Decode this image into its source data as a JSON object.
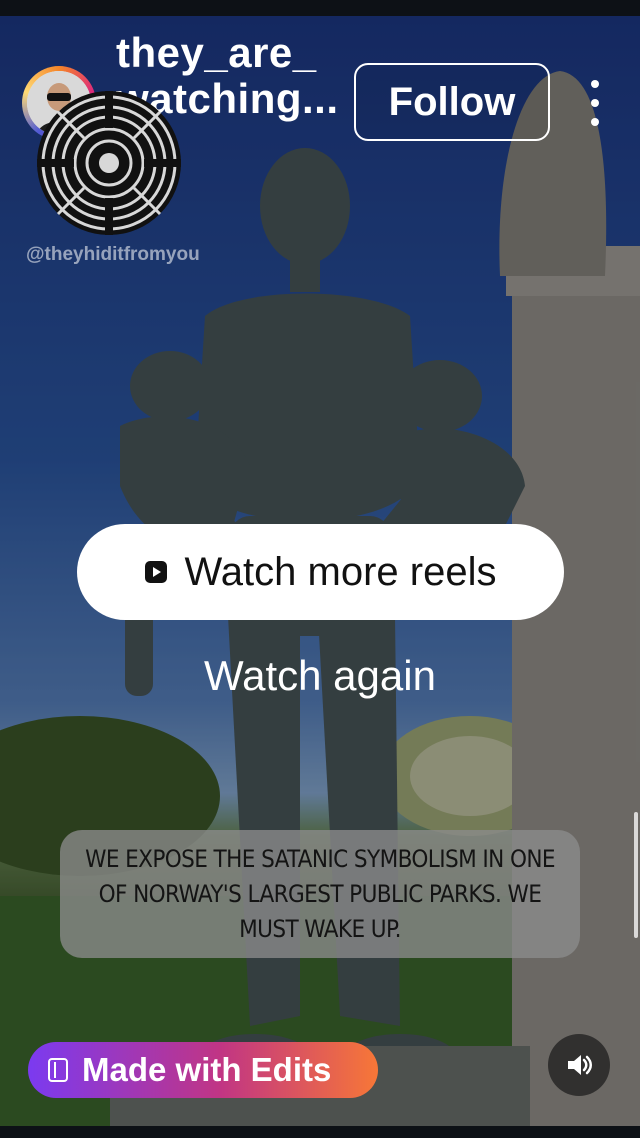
{
  "header": {
    "username": "they_are_\nwatching...",
    "follow_label": "Follow",
    "watermark": "@theyhiditfromyou"
  },
  "actions": {
    "watch_more_label": "Watch more reels",
    "watch_again_label": "Watch again"
  },
  "caption": {
    "text": "WE EXPOSE THE SATANIC SYMBOLISM IN ONE OF NORWAY'S LARGEST PUBLIC PARKS. WE MUST WAKE UP."
  },
  "footer": {
    "edits_label": "Made with Edits"
  },
  "icons": {
    "more": "more-vertical-icon",
    "sound": "speaker-icon",
    "reels": "reels-icon",
    "edits": "edits-icon"
  },
  "colors": {
    "follow_border": "#ffffff",
    "badge_start": "#7b3af0",
    "badge_end": "#f77737"
  }
}
